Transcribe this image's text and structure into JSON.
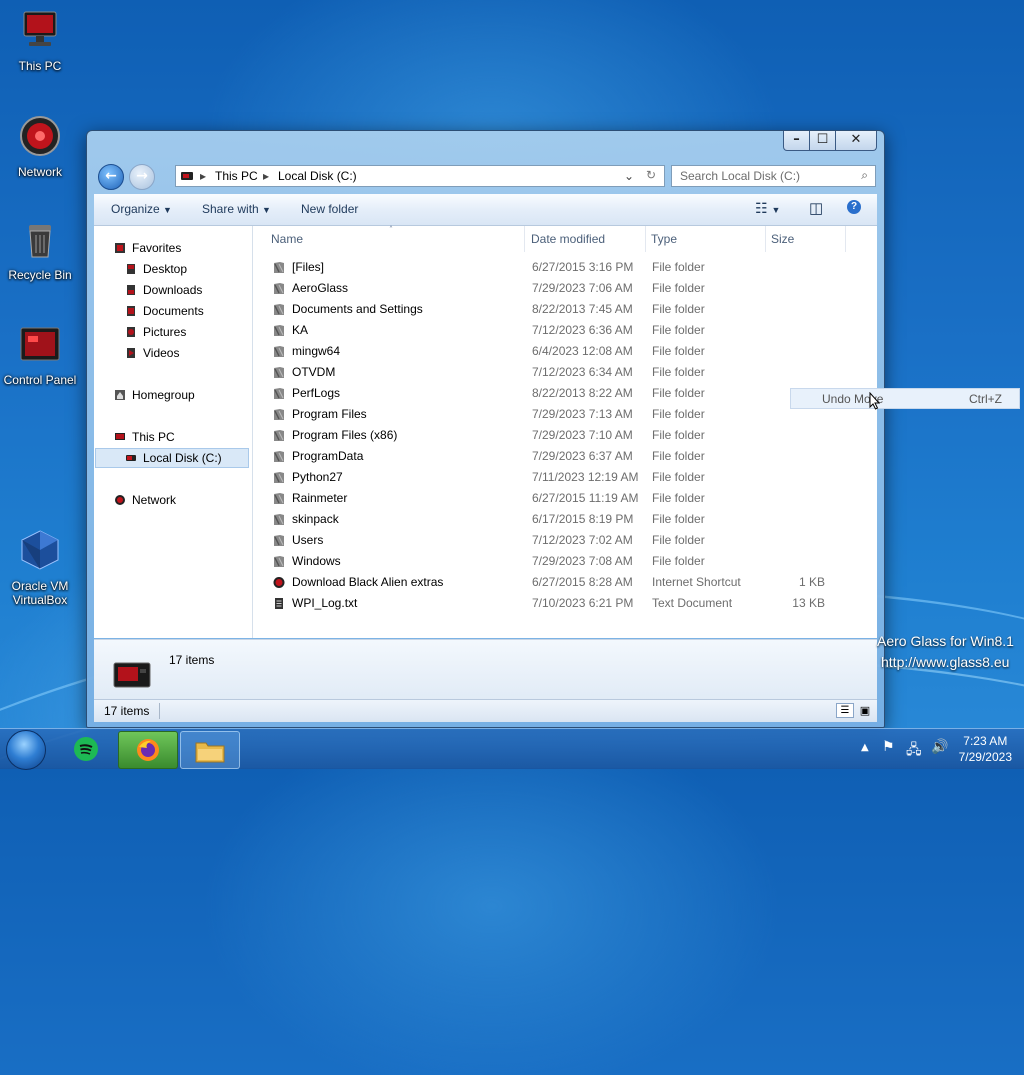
{
  "desktop": {
    "icons": [
      {
        "label": "This PC"
      },
      {
        "label": "Network"
      },
      {
        "label": "Recycle Bin"
      },
      {
        "label": "Control Panel"
      },
      {
        "label": "Oracle VM VirtualBox"
      }
    ],
    "watermark_line1": "Aero Glass for Win8.1",
    "watermark_line2": "http://www.glass8.eu"
  },
  "window": {
    "caption_buttons": {
      "minimize": "–",
      "maximize": "☐",
      "close": "✕"
    },
    "address": {
      "seg1": "This PC",
      "seg2": "Local Disk (C:)"
    },
    "search_placeholder": "Search Local Disk (C:)",
    "toolbar": {
      "organize": "Organize",
      "share_with": "Share with",
      "new_folder": "New folder"
    },
    "nav_pane": {
      "favorites": "Favorites",
      "favorites_items": [
        "Desktop",
        "Downloads",
        "Documents",
        "Pictures",
        "Videos"
      ],
      "homegroup": "Homegroup",
      "this_pc": "This PC",
      "local_disk": "Local Disk (C:)",
      "network": "Network"
    },
    "columns": {
      "name": "Name",
      "date": "Date modified",
      "type": "Type",
      "size": "Size"
    },
    "files": [
      {
        "name": "[Files]",
        "date": "6/27/2015 3:16 PM",
        "type": "File folder",
        "size": ""
      },
      {
        "name": "AeroGlass",
        "date": "7/29/2023 7:06 AM",
        "type": "File folder",
        "size": ""
      },
      {
        "name": "Documents and Settings",
        "date": "8/22/2013 7:45 AM",
        "type": "File folder",
        "size": ""
      },
      {
        "name": "KA",
        "date": "7/12/2023 6:36 AM",
        "type": "File folder",
        "size": ""
      },
      {
        "name": "mingw64",
        "date": "6/4/2023 12:08 AM",
        "type": "File folder",
        "size": ""
      },
      {
        "name": "OTVDM",
        "date": "7/12/2023 6:34 AM",
        "type": "File folder",
        "size": ""
      },
      {
        "name": "PerfLogs",
        "date": "8/22/2013 8:22 AM",
        "type": "File folder",
        "size": ""
      },
      {
        "name": "Program Files",
        "date": "7/29/2023 7:13 AM",
        "type": "File folder",
        "size": ""
      },
      {
        "name": "Program Files (x86)",
        "date": "7/29/2023 7:10 AM",
        "type": "File folder",
        "size": ""
      },
      {
        "name": "ProgramData",
        "date": "7/29/2023 6:37 AM",
        "type": "File folder",
        "size": ""
      },
      {
        "name": "Python27",
        "date": "7/11/2023 12:19 AM",
        "type": "File folder",
        "size": ""
      },
      {
        "name": "Rainmeter",
        "date": "6/27/2015 11:19 AM",
        "type": "File folder",
        "size": ""
      },
      {
        "name": "skinpack",
        "date": "6/17/2015 8:19 PM",
        "type": "File folder",
        "size": ""
      },
      {
        "name": "Users",
        "date": "7/12/2023 7:02 AM",
        "type": "File folder",
        "size": ""
      },
      {
        "name": "Windows",
        "date": "7/29/2023 7:08 AM",
        "type": "File folder",
        "size": ""
      },
      {
        "name": "Download Black Alien extras",
        "date": "6/27/2015 8:28 AM",
        "type": "Internet Shortcut",
        "size": "1 KB"
      },
      {
        "name": "WPI_Log.txt",
        "date": "7/10/2023 6:21 PM",
        "type": "Text Document",
        "size": "13 KB"
      }
    ],
    "details_count": "17 items",
    "status_count": "17 items"
  },
  "context_menu": {
    "label": "Undo Move",
    "shortcut": "Ctrl+Z"
  },
  "taskbar": {
    "time": "7:23 AM",
    "date": "7/29/2023"
  },
  "colors": {
    "accent": "#1e395b",
    "selection": "#cce4f7",
    "folder": "#7a7a7a"
  }
}
